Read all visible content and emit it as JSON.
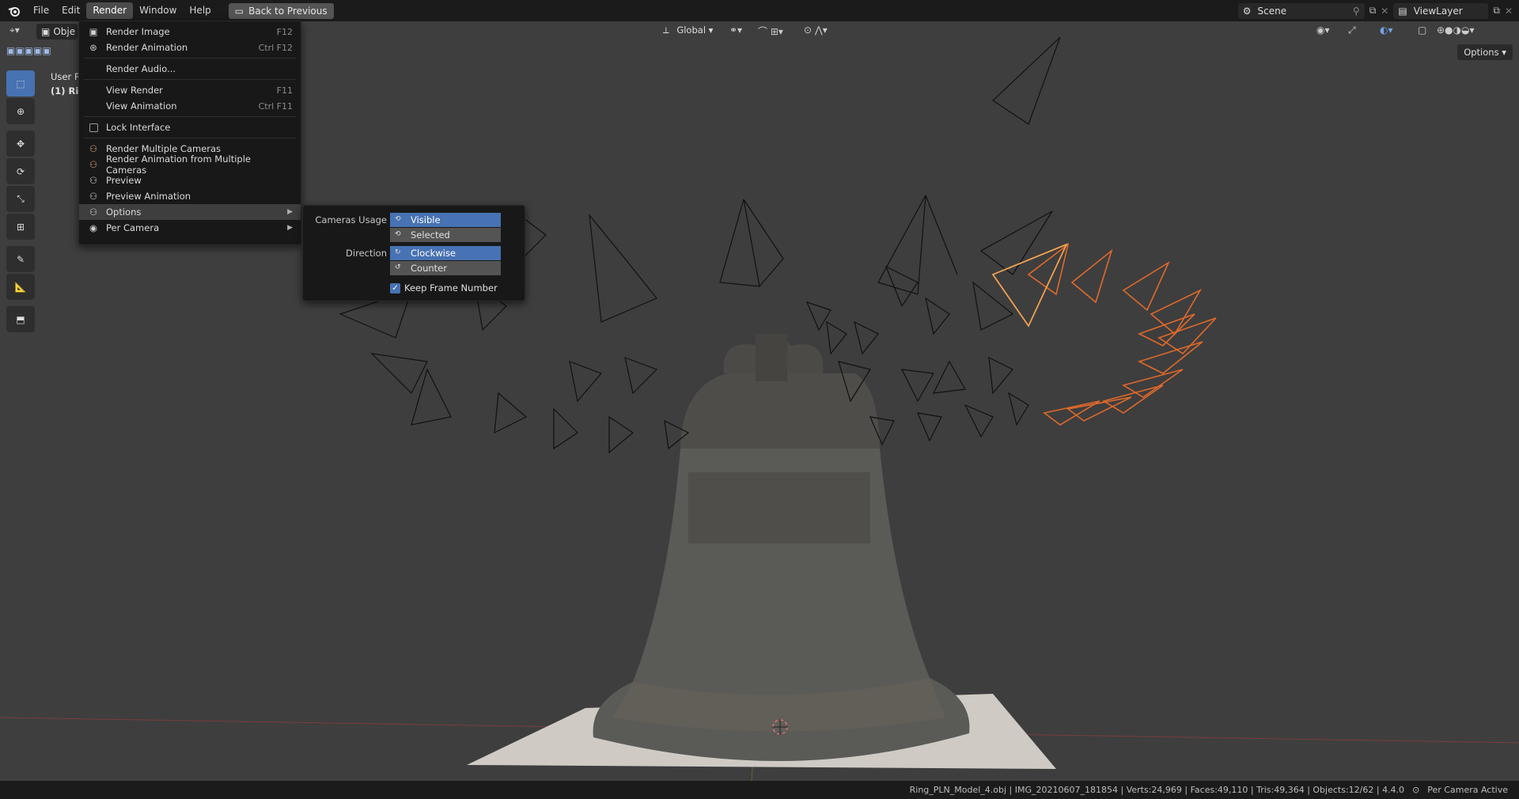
{
  "menubar": {
    "items": [
      "File",
      "Edit",
      "Render",
      "Window",
      "Help"
    ],
    "active": "Render",
    "back_button": "Back to Previous"
  },
  "top_right": {
    "scene_label": "Scene",
    "viewlayer_label": "ViewLayer"
  },
  "viewport": {
    "mode_label": "Obje",
    "transform_orientation": "Global",
    "options_label": "Options",
    "overlay_line1": "User P",
    "overlay_line2": "(1) Rin"
  },
  "render_menu": {
    "items": [
      {
        "label": "Render Image",
        "shortcut": "F12",
        "icon": "render-image-icon"
      },
      {
        "label": "Render Animation",
        "shortcut": "Ctrl F12",
        "icon": "render-animation-icon"
      },
      {
        "label": "Render Audio...",
        "shortcut": "",
        "icon": ""
      },
      {
        "label": "View Render",
        "shortcut": "F11",
        "icon": ""
      },
      {
        "label": "View Animation",
        "shortcut": "Ctrl F11",
        "icon": ""
      },
      {
        "label": "Lock Interface",
        "shortcut": "",
        "icon": "checkbox-icon"
      },
      {
        "label": "Render Multiple Cameras",
        "shortcut": "",
        "icon": "multi-camera-icon"
      },
      {
        "label": "Render Animation from Multiple Cameras",
        "shortcut": "",
        "icon": "multi-camera-anim-icon"
      },
      {
        "label": "Preview",
        "shortcut": "",
        "icon": "preview-icon"
      },
      {
        "label": "Preview Animation",
        "shortcut": "",
        "icon": "preview-anim-icon"
      },
      {
        "label": "Options",
        "shortcut": "",
        "icon": "options-icon"
      },
      {
        "label": "Per Camera",
        "shortcut": "",
        "icon": "per-camera-icon"
      }
    ]
  },
  "options_submenu": {
    "cameras_usage_label": "Cameras Usage",
    "cameras_usage_options": [
      "Visible",
      "Selected"
    ],
    "cameras_usage_selected": "Visible",
    "direction_label": "Direction",
    "direction_options": [
      "Clockwise",
      "Counter"
    ],
    "direction_selected": "Clockwise",
    "keep_frame_label": "Keep Frame Number",
    "keep_frame_checked": true
  },
  "statusbar": {
    "text": "Ring_PLN_Model_4.obj | IMG_20210607_181854 | Verts:24,969 | Faces:49,110 | Tris:49,364 | Objects:12/62 | 4.4.0",
    "right_label": "Per Camera Active"
  },
  "colors": {
    "accent": "#4772b3",
    "selected_camera": "#e0692a",
    "active_camera": "#f0a050",
    "viewport_bg": "#3e3e3e"
  }
}
